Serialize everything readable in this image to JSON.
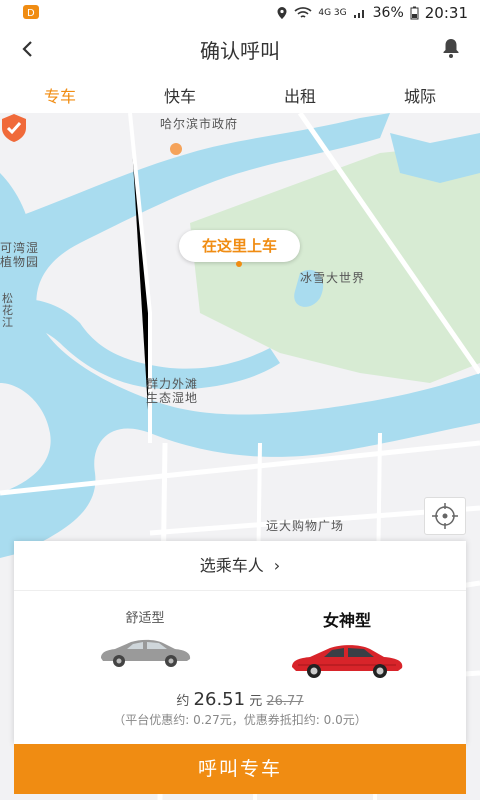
{
  "status": {
    "signal_text": "4G 3G",
    "battery": "36%",
    "time": "20:31"
  },
  "header": {
    "title": "确认呼叫"
  },
  "tabs": [
    {
      "label": "专车",
      "active": true
    },
    {
      "label": "快车",
      "active": false
    },
    {
      "label": "出租",
      "active": false
    },
    {
      "label": "城际",
      "active": false
    }
  ],
  "map": {
    "labels": {
      "gov": "哈尔滨市政府",
      "wetland1": "可湾湿",
      "wetland2": "植物园",
      "river": "松花江",
      "snow": "冰雪大世界",
      "qunli1": "群力外滩",
      "qunli2": "生态湿地",
      "mall": "远大购物广场"
    },
    "pickup_label": "在这里上车"
  },
  "card": {
    "passenger_label": "选乘车人",
    "cars": [
      {
        "name": "舒适型",
        "selected": false
      },
      {
        "name": "女神型",
        "selected": true
      }
    ],
    "price_prefix": "约",
    "price": "26.51",
    "price_unit": "元",
    "old_price": "26.77",
    "discount": "（平台优惠约: 0.27元，优惠券抵扣约: 0.0元）"
  },
  "call_button": "呼叫专车",
  "colors": {
    "accent": "#f08c12",
    "water": "#a9dcef",
    "park": "#d7ebd3"
  }
}
